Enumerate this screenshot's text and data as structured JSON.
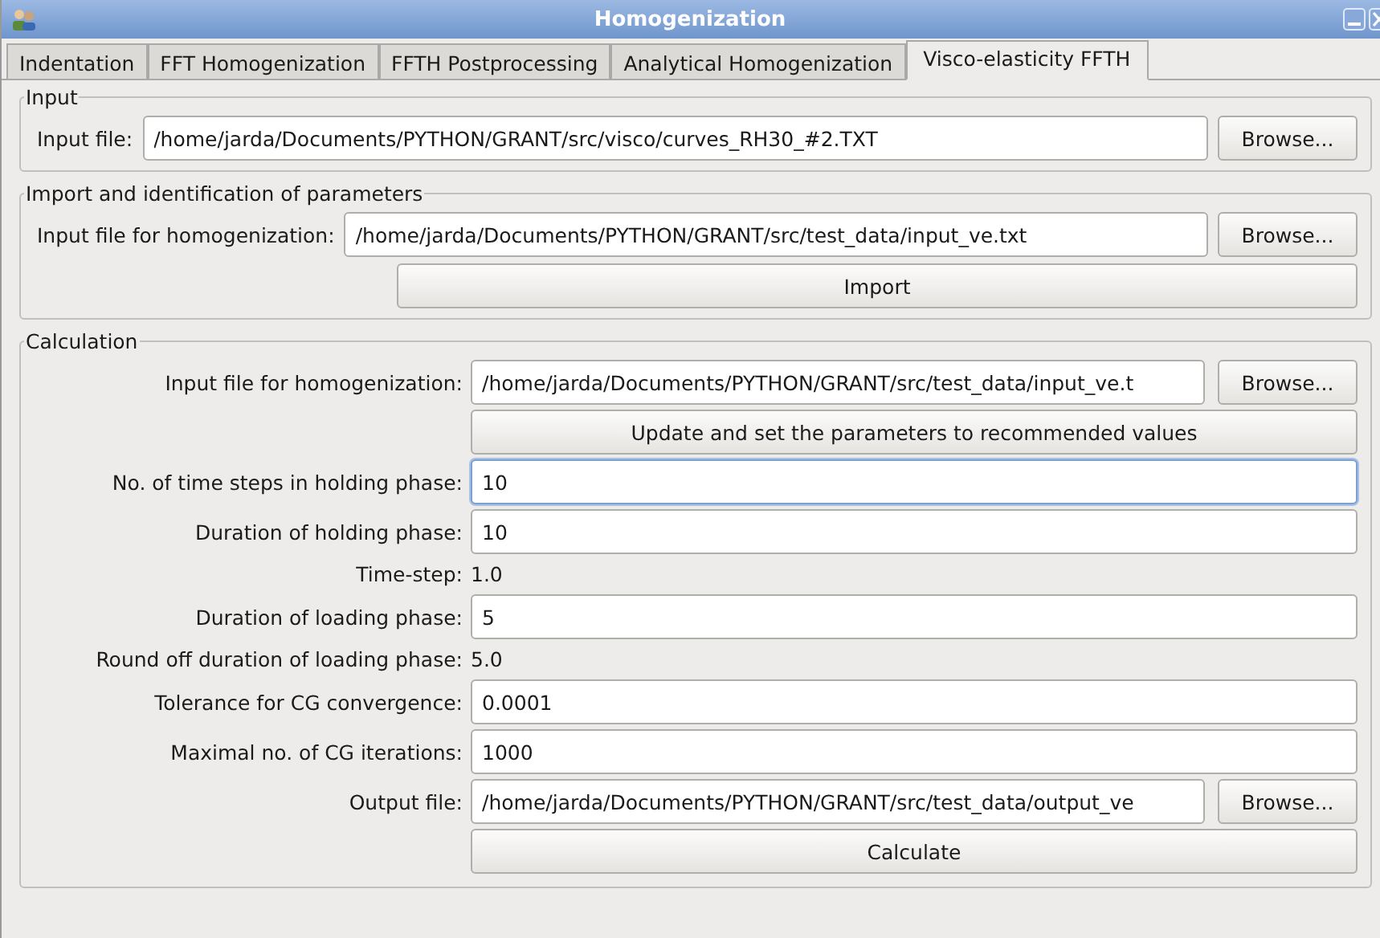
{
  "window": {
    "title": "Homogenization"
  },
  "tabs": [
    {
      "label": "Indentation",
      "selected": false
    },
    {
      "label": "FFT Homogenization",
      "selected": false
    },
    {
      "label": "FFTH Postprocessing",
      "selected": false
    },
    {
      "label": "Analytical Homogenization",
      "selected": false
    },
    {
      "label": "Visco-elasticity FFTH",
      "selected": true
    }
  ],
  "input_group": {
    "title": "Input",
    "label": "Input file:",
    "value": "/home/jarda/Documents/PYTHON/GRANT/src/visco/curves_RH30_#2.TXT",
    "button": "Browse..."
  },
  "import_group": {
    "title": "Import and identification of parameters",
    "label": "Input file for homogenization:",
    "value": "/home/jarda/Documents/PYTHON/GRANT/src/test_data/input_ve.txt",
    "button": "Browse...",
    "action": "Import"
  },
  "calculation_group": {
    "title": "Calculation",
    "rows": [
      {
        "kind": "file",
        "label": "Input file for homogenization:",
        "value": "/home/jarda/Documents/PYTHON/GRANT/src/test_data/input_ve.t",
        "button": "Browse..."
      },
      {
        "kind": "button",
        "label": "Update and set the parameters to recommended values"
      },
      {
        "kind": "input",
        "label": "No. of time steps in holding phase:",
        "value": "10",
        "focused": true
      },
      {
        "kind": "input",
        "label": "Duration of holding phase:",
        "value": "10",
        "focused": false
      },
      {
        "kind": "text",
        "label": "Time-step:",
        "value": "1.0"
      },
      {
        "kind": "input",
        "label": "Duration of loading phase:",
        "value": "5",
        "focused": false
      },
      {
        "kind": "text",
        "label": "Round off duration of loading phase:",
        "value": "5.0"
      },
      {
        "kind": "input",
        "label": "Tolerance for CG convergence:",
        "value": "0.0001",
        "focused": false
      },
      {
        "kind": "input",
        "label": "Maximal no. of CG iterations:",
        "value": "1000",
        "focused": false
      },
      {
        "kind": "file",
        "label": "Output file:",
        "value": "/home/jarda/Documents/PYTHON/GRANT/src/test_data/output_ve",
        "button": "Browse..."
      },
      {
        "kind": "button",
        "label": "Calculate"
      }
    ]
  }
}
